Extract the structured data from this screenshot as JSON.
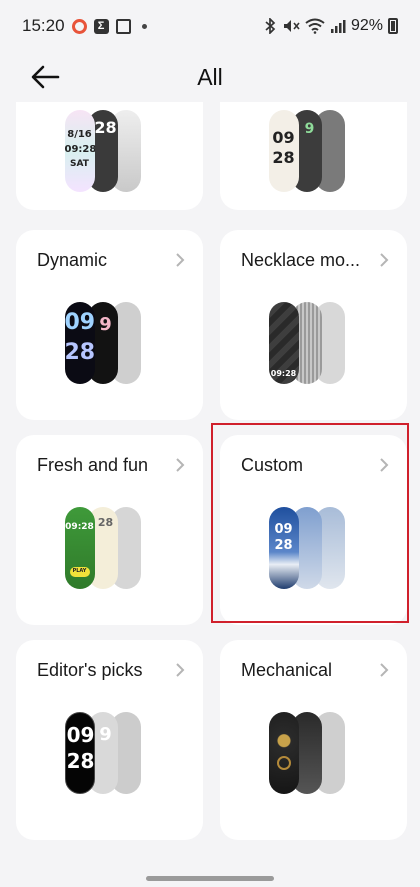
{
  "status": {
    "time": "15:20",
    "battery": "92%"
  },
  "header": {
    "title": "All",
    "back_icon": "arrow-left-icon"
  },
  "cards": [
    {
      "title": "",
      "faces": {
        "text1": "8/16",
        "text2": "09:28",
        "text3": "SAT",
        "side": "28"
      }
    },
    {
      "title": "",
      "faces": {
        "text1": "09",
        "text2": "28",
        "side": "9"
      }
    },
    {
      "title": "Dynamic",
      "faces": {
        "text1": "09",
        "text2": "28"
      }
    },
    {
      "title": "Necklace mo...",
      "faces": {
        "text1": "09:28"
      }
    },
    {
      "title": "Fresh and fun",
      "faces": {
        "text1": "09:28",
        "text2": "PLAY",
        "side": "28"
      }
    },
    {
      "title": "Custom",
      "faces": {
        "text1": "09",
        "text2": "28"
      }
    },
    {
      "title": "Editor's picks",
      "faces": {
        "text1": "09",
        "text2": "28"
      }
    },
    {
      "title": "Mechanical",
      "faces": {}
    }
  ],
  "colors": {
    "highlight": "#d0202c"
  }
}
